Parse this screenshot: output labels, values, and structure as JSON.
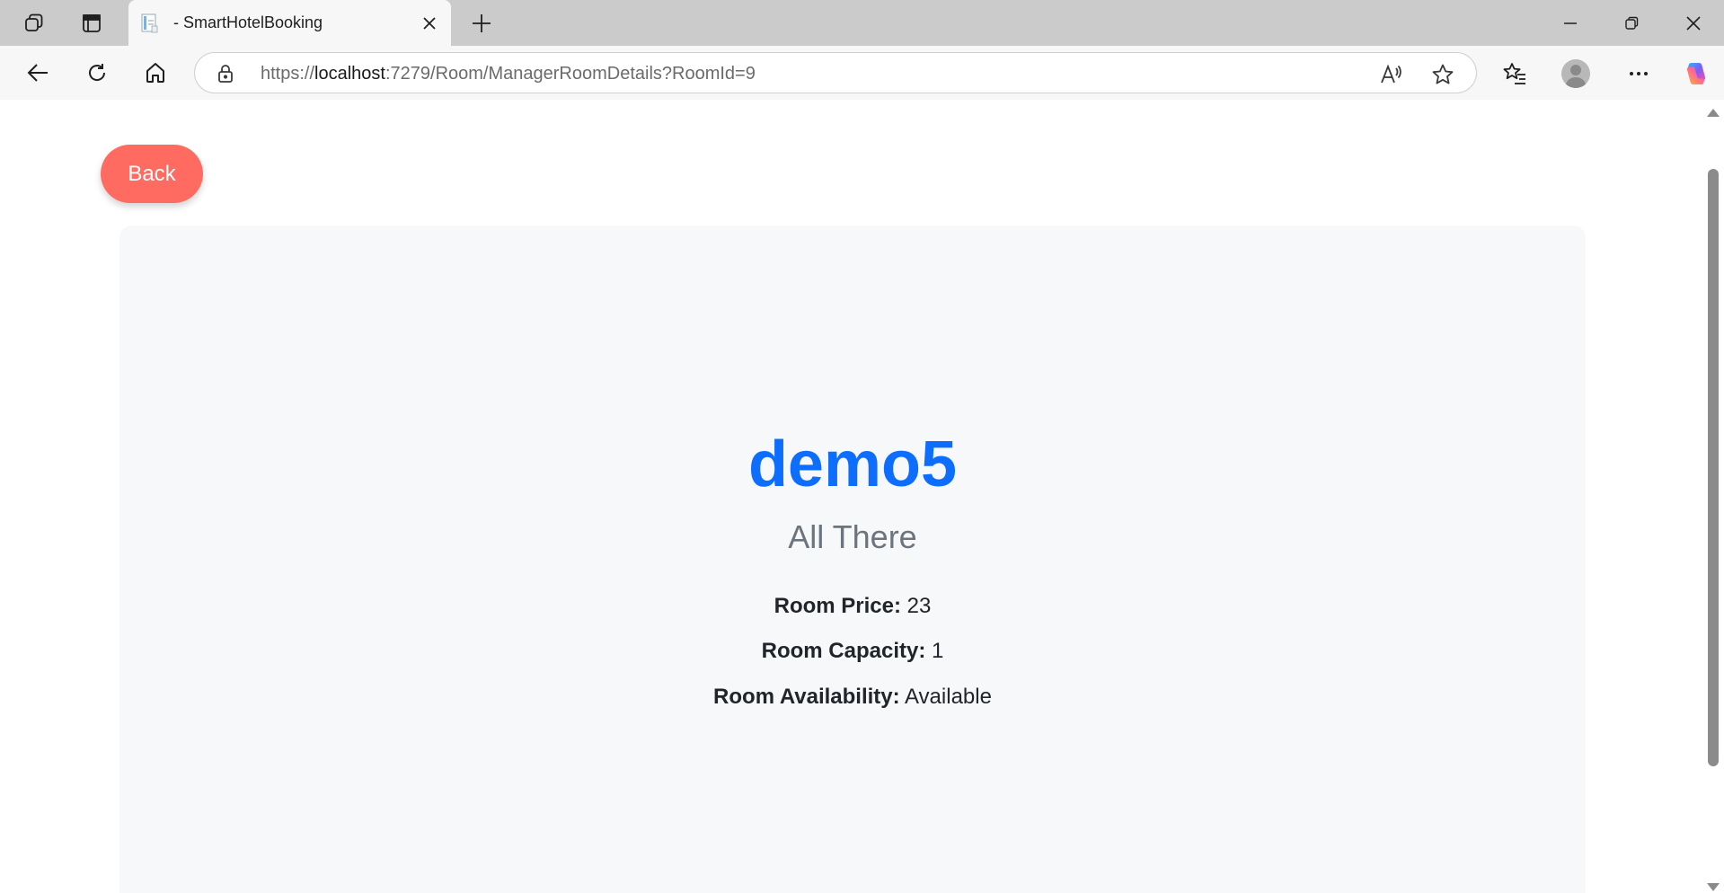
{
  "browser": {
    "tab": {
      "title": "- SmartHotelBooking"
    },
    "address": {
      "scheme": "https://",
      "host": "localhost",
      "path": ":7279/Room/ManagerRoomDetails?RoomId=9"
    },
    "icons": {
      "workspaces": "workspaces-icon",
      "tab_actions": "tab-actions-icon",
      "close_tab": "close-icon",
      "new_tab": "plus-icon",
      "minimize": "minimize-icon",
      "restore": "restore-icon",
      "close_window": "close-icon",
      "back": "arrow-left-icon",
      "refresh": "refresh-icon",
      "home": "home-icon",
      "lock": "lock-icon",
      "read_aloud": "read-aloud-icon",
      "favorite": "star-icon",
      "favorites": "favorites-icon",
      "profile": "avatar-icon",
      "more": "more-icon",
      "copilot": "copilot-icon"
    }
  },
  "page": {
    "back_label": "Back",
    "room": {
      "name": "demo5",
      "description": "All There",
      "price_label": "Room Price:",
      "price_value": "23",
      "capacity_label": "Room Capacity:",
      "capacity_value": "1",
      "availability_label": "Room Availability:",
      "availability_value": "Available"
    }
  },
  "colors": {
    "back_button": "#ff6b61",
    "room_name": "#0d6efd",
    "description": "#6c757d",
    "card_background": "#f7f8f9"
  }
}
